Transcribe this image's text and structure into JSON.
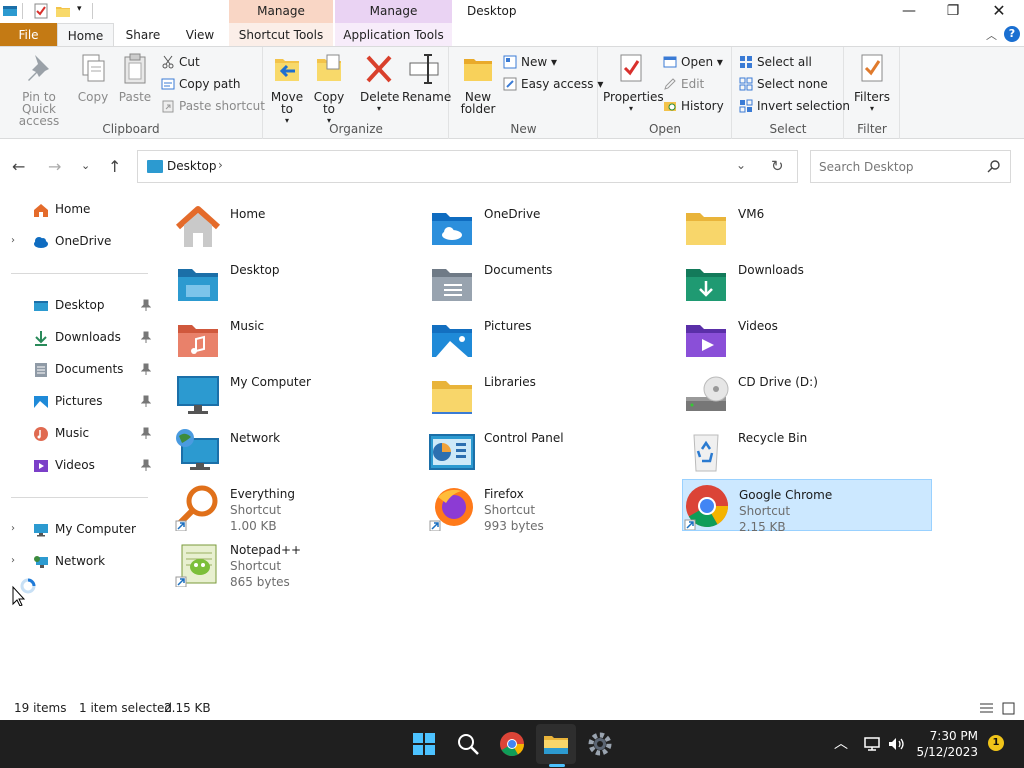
{
  "titlebar": {
    "title": "Desktop",
    "context_headers": [
      "Manage",
      "Manage"
    ]
  },
  "tabs": {
    "file": "File",
    "home": "Home",
    "share": "Share",
    "view": "View",
    "shortcut_tools": "Shortcut Tools",
    "application_tools": "Application Tools"
  },
  "ribbon": {
    "clipboard": {
      "label": "Clipboard",
      "pin": "Pin to Quick access",
      "copy": "Copy",
      "paste": "Paste",
      "cut": "Cut",
      "copy_path": "Copy path",
      "paste_shortcut": "Paste shortcut"
    },
    "organize": {
      "label": "Organize",
      "move_to": "Move to",
      "copy_to": "Copy to",
      "delete": "Delete",
      "rename": "Rename"
    },
    "new": {
      "label": "New",
      "new_folder": "New folder",
      "new_item": "New",
      "easy_access": "Easy access"
    },
    "open": {
      "label": "Open",
      "properties": "Properties",
      "open": "Open",
      "edit": "Edit",
      "history": "History"
    },
    "select": {
      "label": "Select",
      "select_all": "Select all",
      "select_none": "Select none",
      "invert": "Invert selection"
    },
    "filter": {
      "label": "Filter",
      "filters": "Filters"
    }
  },
  "address": {
    "path": "Desktop",
    "separator": "›",
    "search_placeholder": "Search Desktop"
  },
  "navpane": {
    "home": "Home",
    "onedrive": "OneDrive",
    "quick": [
      "Desktop",
      "Downloads",
      "Documents",
      "Pictures",
      "Music",
      "Videos"
    ],
    "my_computer": "My Computer",
    "network": "Network"
  },
  "items": [
    {
      "name": "Home"
    },
    {
      "name": "OneDrive"
    },
    {
      "name": "VM6"
    },
    {
      "name": "Desktop"
    },
    {
      "name": "Documents"
    },
    {
      "name": "Downloads"
    },
    {
      "name": "Music"
    },
    {
      "name": "Pictures"
    },
    {
      "name": "Videos"
    },
    {
      "name": "My Computer"
    },
    {
      "name": "Libraries"
    },
    {
      "name": "CD Drive (D:)"
    },
    {
      "name": "Network"
    },
    {
      "name": "Control Panel"
    },
    {
      "name": "Recycle Bin"
    },
    {
      "name": "Everything",
      "type": "Shortcut",
      "size": "1.00 KB"
    },
    {
      "name": "Firefox",
      "type": "Shortcut",
      "size": "993 bytes"
    },
    {
      "name": "Google Chrome",
      "type": "Shortcut",
      "size": "2.15 KB"
    },
    {
      "name": "Notepad++",
      "type": "Shortcut",
      "size": "865 bytes"
    }
  ],
  "status": {
    "count": "19 items",
    "selected": "1 item selected",
    "size": "2.15 KB"
  },
  "taskbar": {
    "time": "7:30 PM",
    "date": "5/12/2023",
    "notifications": "1"
  },
  "colors": {
    "file_tab": "#c47a14",
    "selection": "#cce8ff",
    "accent": "#0078d4",
    "taskbar": "#1f1f1f"
  }
}
